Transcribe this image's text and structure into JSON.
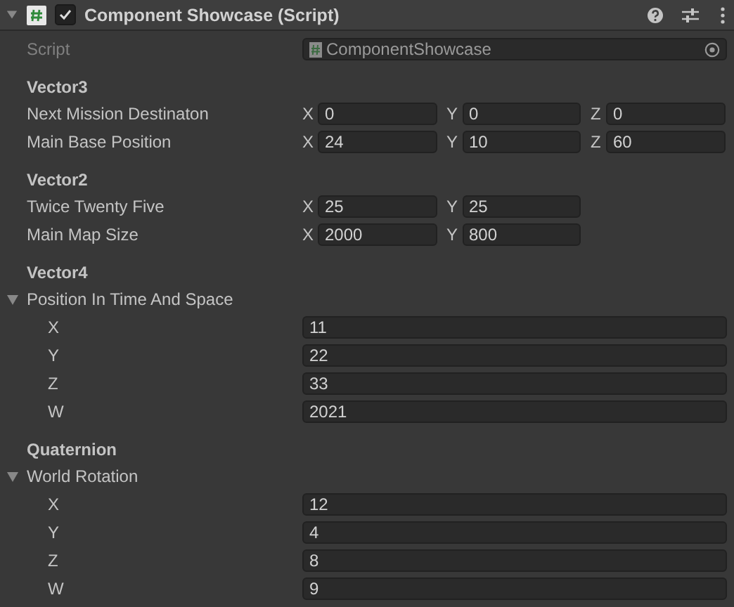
{
  "component": {
    "title": "Component Showcase (Script)",
    "enabled": true,
    "expanded": true
  },
  "script_field": {
    "label": "Script",
    "value": "ComponentShowcase",
    "disabled": true
  },
  "sections": [
    {
      "heading": "Vector3",
      "rows": [
        {
          "kind": "vector",
          "label": "Next Mission Destinaton",
          "components": [
            {
              "axis": "X",
              "value": "0"
            },
            {
              "axis": "Y",
              "value": "0"
            },
            {
              "axis": "Z",
              "value": "0"
            }
          ]
        },
        {
          "kind": "vector",
          "label": "Main Base Position",
          "components": [
            {
              "axis": "X",
              "value": "24"
            },
            {
              "axis": "Y",
              "value": "10"
            },
            {
              "axis": "Z",
              "value": "60"
            }
          ]
        }
      ]
    },
    {
      "heading": "Vector2",
      "rows": [
        {
          "kind": "vector",
          "label": "Twice Twenty Five",
          "components": [
            {
              "axis": "X",
              "value": "25"
            },
            {
              "axis": "Y",
              "value": "25"
            }
          ]
        },
        {
          "kind": "vector",
          "label": "Main Map Size",
          "components": [
            {
              "axis": "X",
              "value": "2000"
            },
            {
              "axis": "Y",
              "value": "800"
            }
          ]
        }
      ]
    },
    {
      "heading": "Vector4",
      "rows": [
        {
          "kind": "foldout",
          "label": "Position In Time And Space",
          "expanded": true,
          "children": [
            {
              "label": "X",
              "value": "11"
            },
            {
              "label": "Y",
              "value": "22"
            },
            {
              "label": "Z",
              "value": "33"
            },
            {
              "label": "W",
              "value": "2021"
            }
          ]
        }
      ]
    },
    {
      "heading": "Quaternion",
      "rows": [
        {
          "kind": "foldout",
          "label": "World Rotation",
          "expanded": true,
          "children": [
            {
              "label": "X",
              "value": "12"
            },
            {
              "label": "Y",
              "value": "4"
            },
            {
              "label": "Z",
              "value": "8"
            },
            {
              "label": "W",
              "value": "9"
            }
          ]
        }
      ]
    }
  ]
}
